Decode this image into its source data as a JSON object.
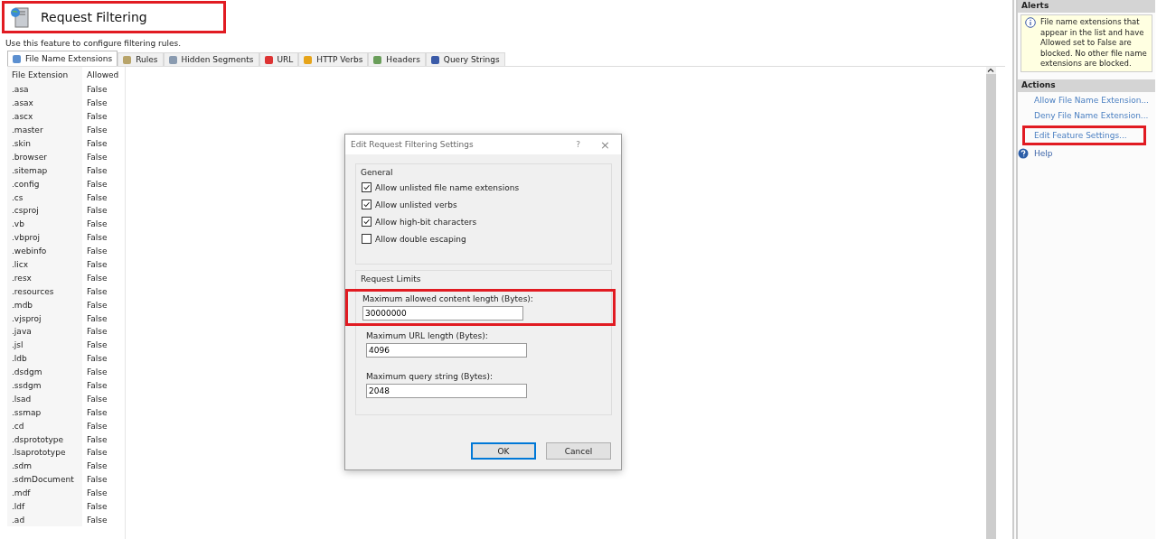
{
  "header": {
    "title": "Request Filtering",
    "highlighted": true,
    "description": "Use this feature to configure filtering rules."
  },
  "tabs": [
    {
      "label": "File Name Extensions",
      "selected": true
    },
    {
      "label": "Rules",
      "selected": false
    },
    {
      "label": "Hidden Segments",
      "selected": false
    },
    {
      "label": "URL",
      "selected": false
    },
    {
      "label": "HTTP Verbs",
      "selected": false
    },
    {
      "label": "Headers",
      "selected": false
    },
    {
      "label": "Query Strings",
      "selected": false
    }
  ],
  "table": {
    "columns": [
      "File Extension",
      "Allowed"
    ],
    "rows": [
      [
        ".asa",
        "False"
      ],
      [
        ".asax",
        "False"
      ],
      [
        ".ascx",
        "False"
      ],
      [
        ".master",
        "False"
      ],
      [
        ".skin",
        "False"
      ],
      [
        ".browser",
        "False"
      ],
      [
        ".sitemap",
        "False"
      ],
      [
        ".config",
        "False"
      ],
      [
        ".cs",
        "False"
      ],
      [
        ".csproj",
        "False"
      ],
      [
        ".vb",
        "False"
      ],
      [
        ".vbproj",
        "False"
      ],
      [
        ".webinfo",
        "False"
      ],
      [
        ".licx",
        "False"
      ],
      [
        ".resx",
        "False"
      ],
      [
        ".resources",
        "False"
      ],
      [
        ".mdb",
        "False"
      ],
      [
        ".vjsproj",
        "False"
      ],
      [
        ".java",
        "False"
      ],
      [
        ".jsl",
        "False"
      ],
      [
        ".ldb",
        "False"
      ],
      [
        ".dsdgm",
        "False"
      ],
      [
        ".ssdgm",
        "False"
      ],
      [
        ".lsad",
        "False"
      ],
      [
        ".ssmap",
        "False"
      ],
      [
        ".cd",
        "False"
      ],
      [
        ".dsprototype",
        "False"
      ],
      [
        ".lsaprototype",
        "False"
      ],
      [
        ".sdm",
        "False"
      ],
      [
        ".sdmDocument",
        "False"
      ],
      [
        ".mdf",
        "False"
      ],
      [
        ".ldf",
        "False"
      ],
      [
        ".ad",
        "False"
      ]
    ]
  },
  "dialog": {
    "title": "Edit Request Filtering Settings",
    "help": "?",
    "close": "×",
    "general": {
      "legend": "General",
      "options": [
        {
          "label": "Allow unlisted file name extensions",
          "checked": true
        },
        {
          "label": "Allow unlisted verbs",
          "checked": true
        },
        {
          "label": "Allow high-bit characters",
          "checked": true
        },
        {
          "label": "Allow double escaping",
          "checked": false
        }
      ]
    },
    "limits": {
      "legend": "Request Limits",
      "fields": [
        {
          "label": "Maximum allowed content length (Bytes):",
          "value": "30000000",
          "highlighted": true
        },
        {
          "label": "Maximum URL length (Bytes):",
          "value": "4096",
          "highlighted": false
        },
        {
          "label": "Maximum query string (Bytes):",
          "value": "2048",
          "highlighted": false
        }
      ]
    },
    "buttons": [
      {
        "label": "OK",
        "default": true
      },
      {
        "label": "Cancel",
        "default": false
      }
    ]
  },
  "alerts": {
    "title": "Alerts",
    "message": "File name extensions that appear in the list and have Allowed set to False are blocked. No other file name extensions are blocked."
  },
  "actions": {
    "title": "Actions",
    "items": [
      {
        "label": "Allow File Name Extension...",
        "kind": "link",
        "highlighted": false
      },
      {
        "label": "Deny File Name Extension...",
        "kind": "link",
        "highlighted": false
      },
      {
        "label": "Edit Feature Settings...",
        "kind": "link",
        "highlighted": true
      },
      {
        "label": "Help",
        "kind": "help",
        "highlighted": false
      }
    ]
  }
}
